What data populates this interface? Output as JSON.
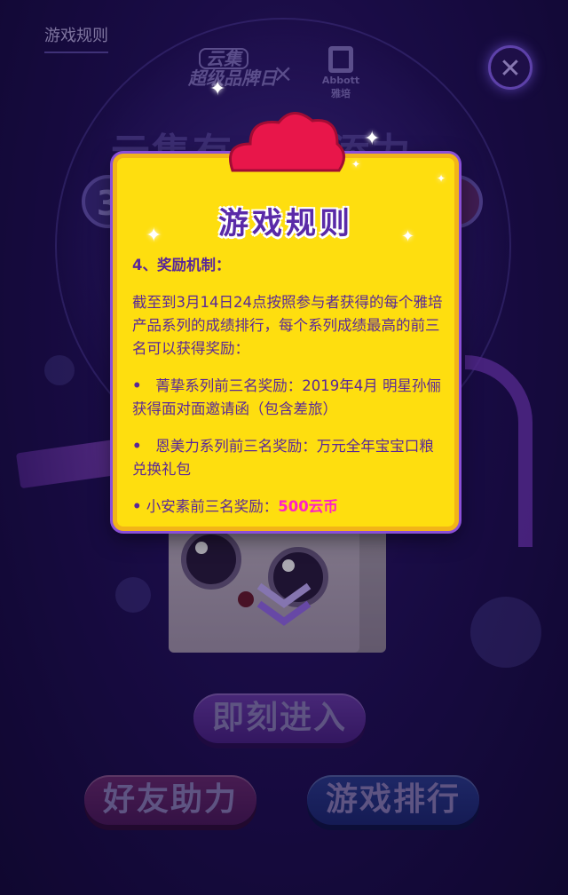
{
  "header": {
    "rules_link_label": "游戏规则",
    "close_symbol": "✕"
  },
  "brand": {
    "yunji_line1": "云集",
    "yunji_line2": "超级品牌日",
    "cross": "×",
    "abbott_en": "Abbott",
    "abbott_cn": "雅培"
  },
  "background": {
    "headline": "云集有      雅培添力",
    "pill_digit": "3"
  },
  "modal": {
    "title": "游戏规则",
    "section_heading": "4、奖励机制：",
    "intro": "截至到3月14日24点按照参与者获得的每个雅培产品系列的成绩排行，每个系列成绩最高的前三名可以获得奖励：",
    "rewards": [
      {
        "bullet": "•",
        "text": "菁挚系列前三名奖励：2019年4月 明星孙俪获得面对面邀请函（包含差旅）"
      },
      {
        "bullet": "•",
        "text": "恩美力系列前三名奖励：万元全年宝宝口粮兑换礼包"
      },
      {
        "bullet": "•",
        "text": "小安素前三名奖励：",
        "highlight": "500云币"
      }
    ]
  },
  "buttons": {
    "enter": "即刻进入",
    "friend": "好友助力",
    "rank": "游戏排行"
  },
  "colors": {
    "modal_bg": "#fede0f",
    "modal_text": "#5a2898",
    "highlight": "#ff1fc8",
    "title": "#5a2aa8"
  }
}
